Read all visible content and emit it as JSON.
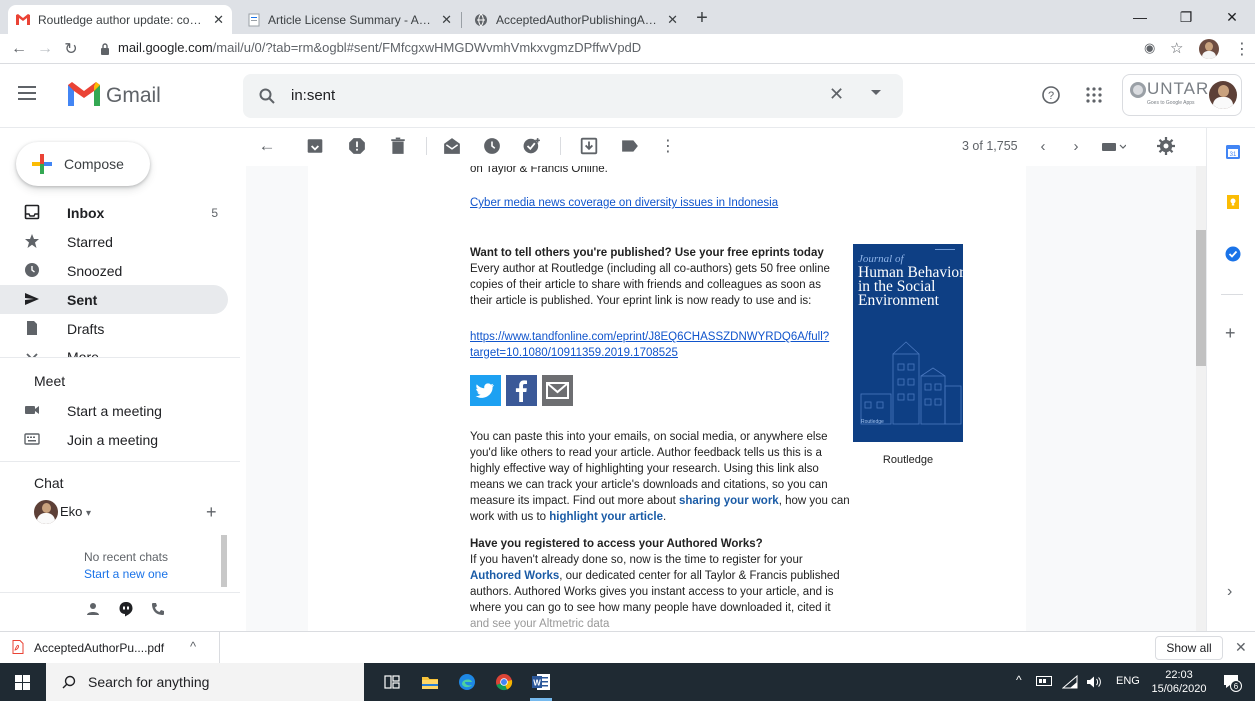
{
  "browser": {
    "tabs": [
      {
        "title": "Routledge author update: congra",
        "active": true
      },
      {
        "title": "Article License Summary - Autho",
        "active": false
      },
      {
        "title": "AcceptedAuthorPublishingAgree",
        "active": false
      }
    ],
    "url_host": "mail.google.com",
    "url_path": "/mail/u/0/?tab=rm&ogbl#sent/FMfcgxwHMGDWvmhVmkxvgmzDPffwVpdD"
  },
  "gmail": {
    "logo_text": "Gmail",
    "search_value": "in:sent",
    "account_badge": "UNTAR",
    "account_sub": "Goes to Google Apps",
    "compose_label": "Compose",
    "nav": [
      {
        "label": "Inbox",
        "count": "5"
      },
      {
        "label": "Starred",
        "count": ""
      },
      {
        "label": "Snoozed",
        "count": ""
      },
      {
        "label": "Sent",
        "count": ""
      },
      {
        "label": "Drafts",
        "count": ""
      },
      {
        "label": "More",
        "count": ""
      }
    ],
    "meet": {
      "title": "Meet",
      "start": "Start a meeting",
      "join": "Join a meeting"
    },
    "chat": {
      "title": "Chat",
      "user": "Eko",
      "empty": "No recent chats",
      "start_new": "Start a new one"
    },
    "pager": "3 of 1,755"
  },
  "email": {
    "cut_top": "on Taylor & Francis Online.",
    "article_link": "Cyber media news coverage on diversity issues in Indonesia",
    "eprints_heading": "Want to tell others you're published? Use your free eprints today",
    "eprints_lines": [
      "Every author at Routledge (including all co-authors) gets 50 free online",
      "copies of their article to share with friends and colleagues as soon as",
      "their article is published. Your eprint link is now ready to use and is:"
    ],
    "eprint_link_1": "https://www.tandfonline.com/eprint/J8EQ6CHASSZDNWYRDQ6A/full?",
    "eprint_link_2": "target=10.1080/10911359.2019.1708525",
    "share_lines": [
      "You can paste this into your emails, on social media, or anywhere else",
      "you'd like others to read your article. Author feedback tells us this is a",
      "highly effective way of highlighting your research. Using this link also",
      "means we can track your article's downloads and citations, so you can"
    ],
    "share_line5_a": "measure its impact. Find out more about ",
    "share_line5_link": "sharing your work",
    "share_line5_b": ", how you can",
    "share_line6_a": "work with us to ",
    "share_line6_link": "highlight your article",
    "share_line6_b": ".",
    "registered_heading": "Have you registered to access your Authored Works?",
    "reg_line1": "If you haven't already done so, now is the time to register for your",
    "reg_line2_link": "Authored Works",
    "reg_line2_b": ", our dedicated center for all Taylor & Francis published",
    "reg_lines": [
      "authors. Authored Works gives you instant access to your article, and is",
      "where you can go to see how many people have downloaded it, cited it"
    ],
    "reg_cut": "and see your Altmetric data",
    "journal": {
      "line1": "Journal of",
      "line2": "Human Behavior",
      "line3": "in the Social",
      "line4": "Environment",
      "publisher_mark": "Routledge",
      "caption": "Routledge"
    }
  },
  "downloads": {
    "file": "AcceptedAuthorPu....pdf",
    "show_all": "Show all"
  },
  "taskbar": {
    "search_placeholder": "Search for anything",
    "lang": "ENG",
    "time": "22:03",
    "date": "15/06/2020",
    "notifications": "6"
  },
  "colors": {
    "gmail_red": "#ea4335",
    "link_blue": "#1155cc",
    "journal_blue": "#0e3f84",
    "taskbar": "#1f2a33"
  }
}
